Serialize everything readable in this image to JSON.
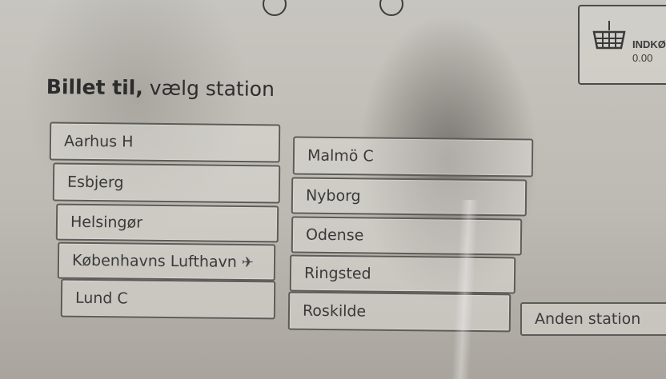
{
  "header": {
    "title_bold": "Billet til,",
    "title_rest": "vælg station"
  },
  "basket": {
    "icon": "basket-icon",
    "label": "INDKØ",
    "amount": "0.00"
  },
  "stations": {
    "left": [
      {
        "label": "Aarhus H"
      },
      {
        "label": "Esbjerg"
      },
      {
        "label": "Helsingør"
      },
      {
        "label": "Københavns Lufthavn",
        "icon": "airplane-icon"
      },
      {
        "label": "Lund C"
      }
    ],
    "right": [
      {
        "label": "Malmö C"
      },
      {
        "label": "Nyborg"
      },
      {
        "label": "Odense"
      },
      {
        "label": "Ringsted"
      },
      {
        "label": "Roskilde"
      }
    ]
  },
  "other_station": {
    "label": "Anden station"
  }
}
